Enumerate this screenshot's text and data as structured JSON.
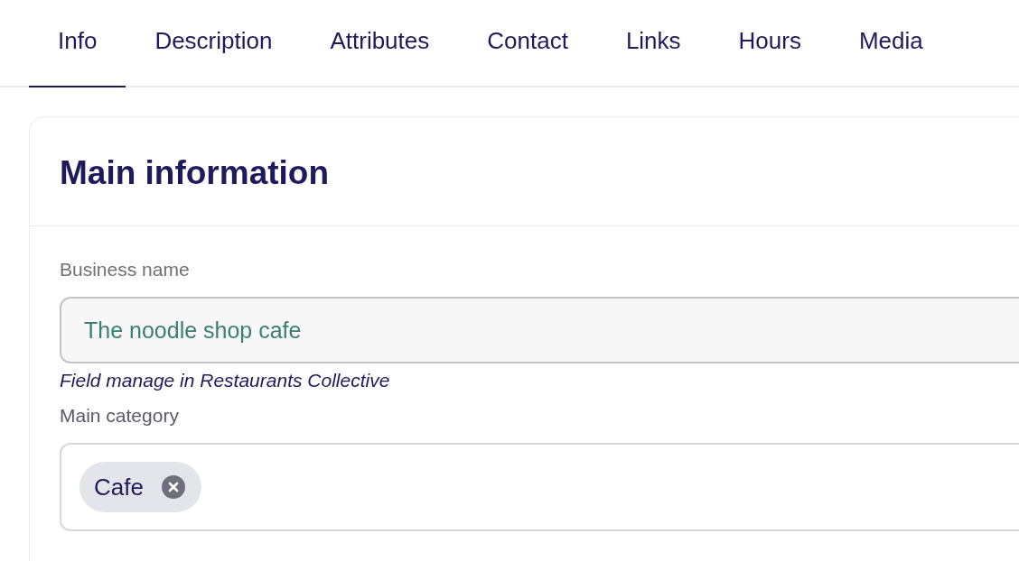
{
  "tabs": [
    {
      "label": "Info",
      "selected": true
    },
    {
      "label": "Description",
      "selected": false
    },
    {
      "label": "Attributes",
      "selected": false
    },
    {
      "label": "Contact",
      "selected": false
    },
    {
      "label": "Links",
      "selected": false
    },
    {
      "label": "Hours",
      "selected": false
    },
    {
      "label": "Media",
      "selected": false
    }
  ],
  "card": {
    "title": "Main information",
    "fields": [
      {
        "kind": "text",
        "label": "Business name",
        "value": "The noodle shop cafe",
        "help": "Field manage in Restaurants Collective"
      },
      {
        "kind": "tags",
        "label": "Main category",
        "tags": [
          "Cafe"
        ]
      }
    ]
  }
}
